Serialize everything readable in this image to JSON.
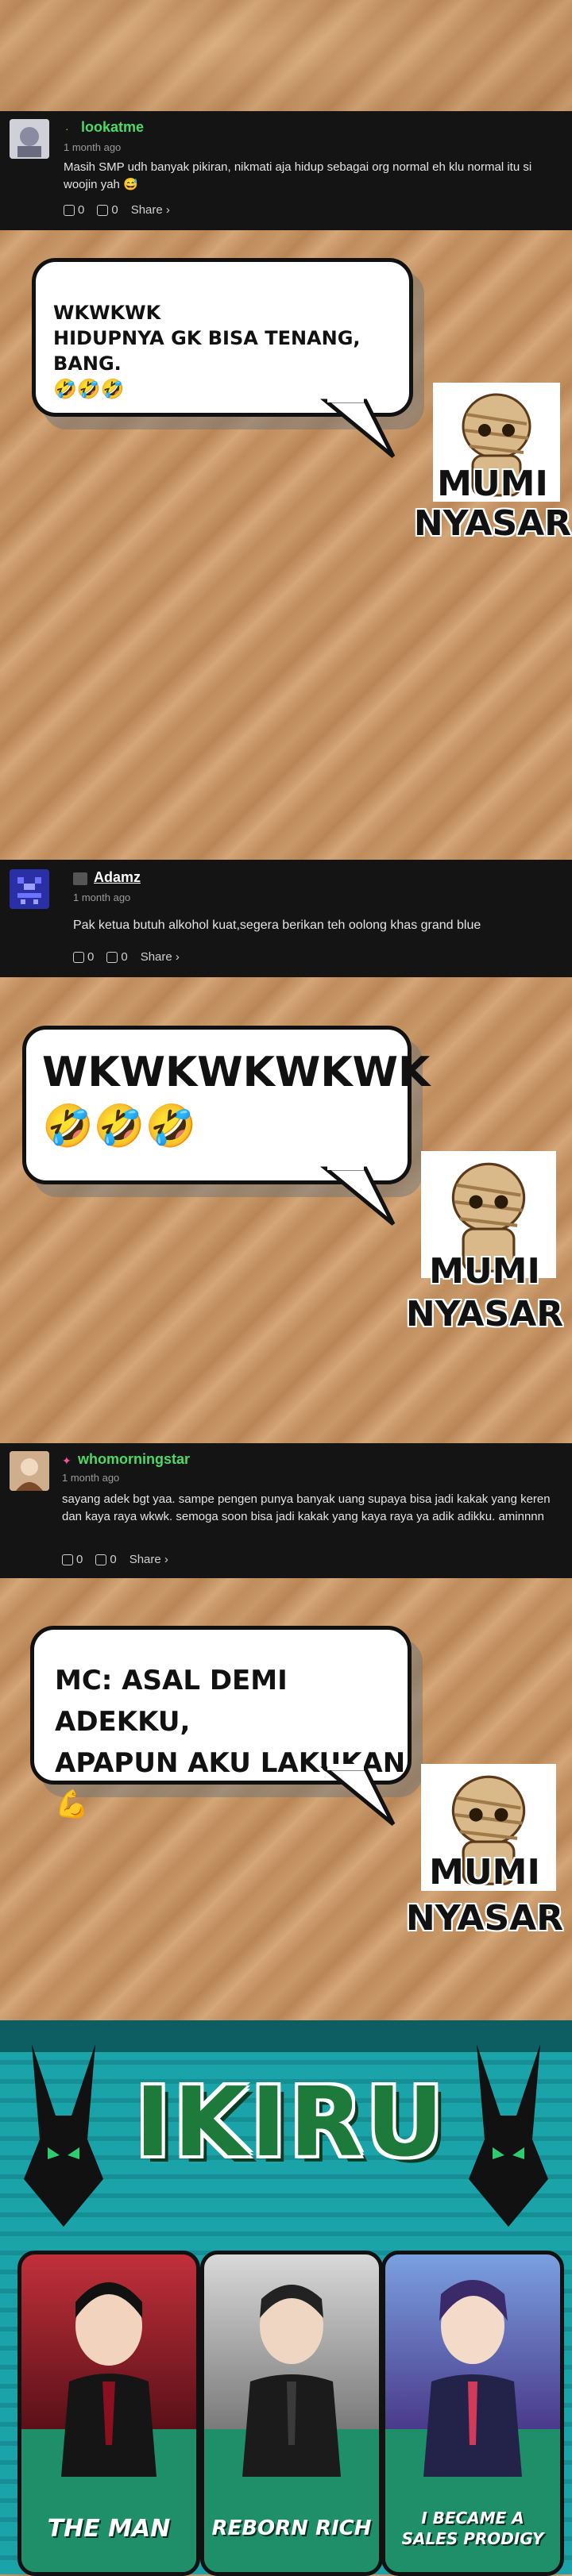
{
  "comments": [
    {
      "username": "lookatme",
      "time": "1 month ago",
      "text": "Masih SMP udh banyak pikiran, nikmati aja hidup sebagai org normal eh klu normal itu si woojin yah 😅",
      "likes": "0",
      "dislikes": "0",
      "share": "Share ›",
      "name_color": "#4cd964"
    },
    {
      "username": "Adamz",
      "time": "1 month ago",
      "text": "Pak ketua butuh alkohol kuat,segera berikan teh oolong khas grand blue",
      "likes": "0",
      "dislikes": "0",
      "share": "Share ›",
      "name_color": "#ffffff"
    },
    {
      "username": "whomorningstar",
      "time": "1 month ago",
      "text": "sayang adek bgt yaa. sampe pengen punya banyak uang supaya bisa jadi kakak yang keren dan kaya raya wkwk. semoga soon bisa jadi kakak yang kaya raya ya adik adikku. aminnnn",
      "likes": "0",
      "dislikes": "0",
      "share": "Share ›",
      "name_color": "#4cd964"
    }
  ],
  "bubbles": [
    {
      "line1": "WKWKWK",
      "line2": "HIDUPNYA GK BISA TENANG, BANG.",
      "line3": "🤣🤣🤣"
    },
    {
      "line1": "WKWKWKWKWK",
      "line2": "🤣🤣🤣"
    },
    {
      "line1": "MC: ASAL DEMI ADEKKU,",
      "line2": "APAPUN AKU LAKUKAN 💪"
    }
  ],
  "mumi": {
    "line1": "MUMI",
    "line2": "NYASAR"
  },
  "banner": {
    "logo": "IKIRU",
    "cards": [
      {
        "title": "THE MAN"
      },
      {
        "title": "REBORN RICH"
      },
      {
        "title_line1": "I BECAME A",
        "title_line2": "SALES PRODIGY"
      }
    ]
  }
}
